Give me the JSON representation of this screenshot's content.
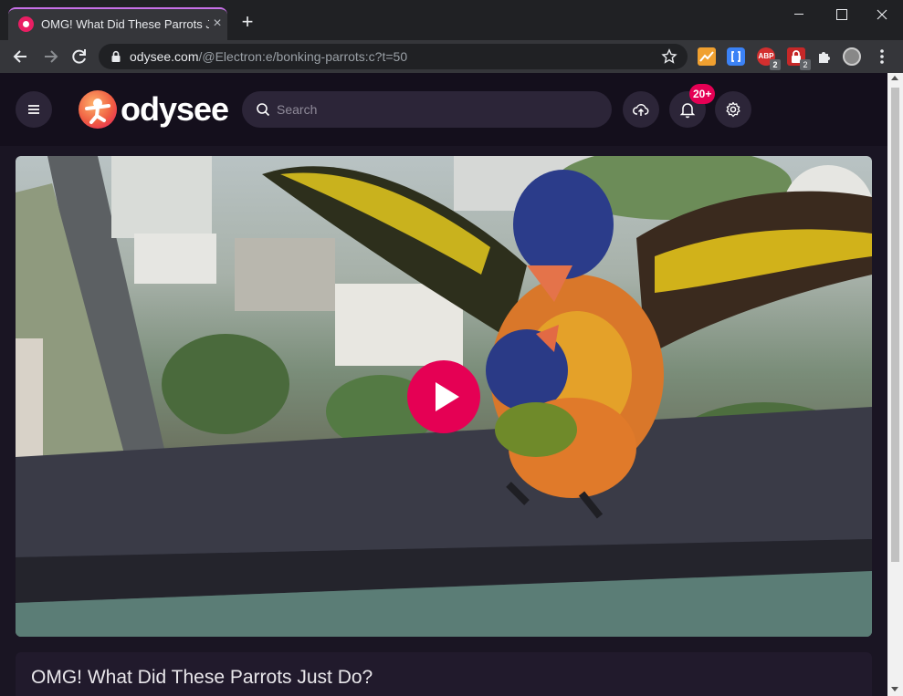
{
  "browser": {
    "tab": {
      "title": "OMG! What Did These Parrots Ju",
      "close_glyph": "×",
      "favicon": "odysee-favicon"
    },
    "new_tab_glyph": "+",
    "window_controls": [
      "minimize-icon",
      "maximize-icon",
      "close-icon"
    ],
    "address": {
      "host": "odysee.com",
      "path": "/@Electron:e/bonking-parrots:c?t=50"
    },
    "extensions": [
      {
        "icon": "chart-extension-icon"
      },
      {
        "icon": "bracket-extension-icon"
      },
      {
        "icon": "adblock-plus-icon",
        "label": "ABP",
        "badge": "2"
      },
      {
        "icon": "lock-extension-icon",
        "badge": "2"
      },
      {
        "icon": "puzzle-icon"
      },
      {
        "icon": "profile-avatar-icon"
      }
    ]
  },
  "site": {
    "brand": "odysee",
    "search": {
      "placeholder": "Search"
    },
    "notifications": {
      "count": "20+"
    },
    "accent_color": "#e50054"
  },
  "video": {
    "title": "OMG! What Did These Parrots Just Do?",
    "action": "play-icon"
  }
}
